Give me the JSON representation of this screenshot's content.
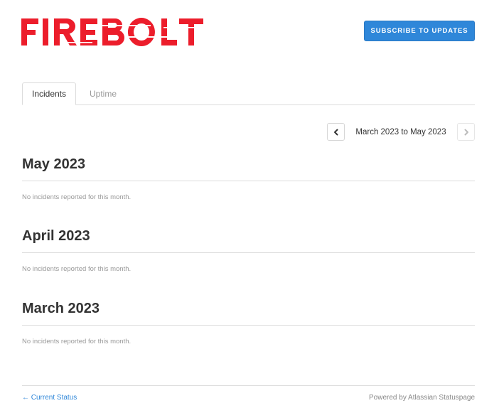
{
  "header": {
    "logo_text": "FIREBOLT",
    "subscribe_label": "SUBSCRIBE TO UPDATES"
  },
  "tabs": [
    {
      "label": "Incidents",
      "active": true
    },
    {
      "label": "Uptime",
      "active": false
    }
  ],
  "pager": {
    "range_label": "March 2023 to May 2023",
    "prev_icon": "chevron-left-icon",
    "next_icon": "chevron-right-icon"
  },
  "months": [
    {
      "title": "May 2023",
      "empty_text": "No incidents reported for this month."
    },
    {
      "title": "April 2023",
      "empty_text": "No incidents reported for this month."
    },
    {
      "title": "March 2023",
      "empty_text": "No incidents reported for this month."
    }
  ],
  "footer": {
    "current_status_label": "← Current Status",
    "powered_by": "Powered by Atlassian Statuspage"
  },
  "colors": {
    "brand_red": "#ec1d2b",
    "accent_blue": "#2f87d9"
  }
}
